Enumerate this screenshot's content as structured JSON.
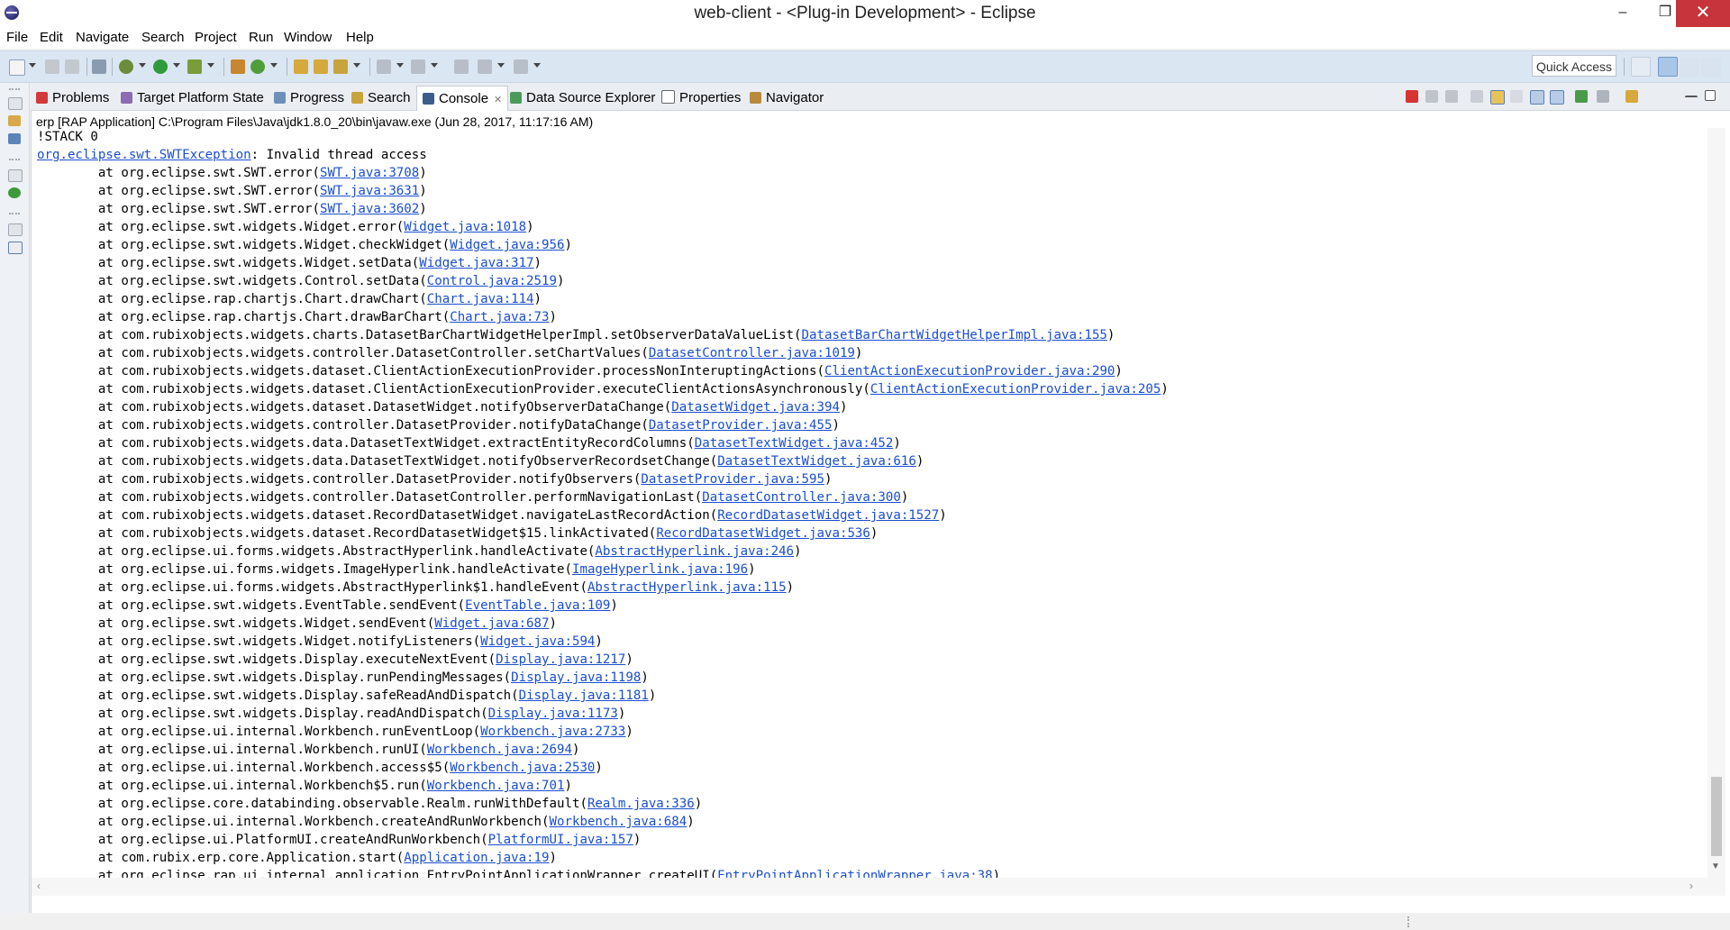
{
  "window": {
    "title": "web-client - <Plug-in Development> - Eclipse",
    "minimize": "–",
    "maximize": "❐",
    "close": "✕"
  },
  "menu": [
    "File",
    "Edit",
    "Navigate",
    "Search",
    "Project",
    "Run",
    "Window",
    "Help"
  ],
  "toolbar": {
    "quick_access": "Quick Access"
  },
  "tabs": {
    "problems": "Problems",
    "target_platform_state": "Target Platform State",
    "progress": "Progress",
    "search": "Search",
    "console": "Console",
    "data_source_explorer": "Data Source Explorer",
    "properties": "Properties",
    "navigator": "Navigator",
    "active": "Console"
  },
  "console": {
    "description": "erp [RAP Application] C:\\Program Files\\Java\\jdk1.8.0_20\\bin\\javaw.exe (Jun 28, 2017, 11:17:16 AM)",
    "lines": [
      {
        "t": "!STACK 0"
      },
      {
        "t": "",
        "l": "org.eclipse.swt.SWTException",
        "s": ": Invalid thread access"
      },
      {
        "t": "\tat org.eclipse.swt.SWT.error(",
        "l": "SWT.java:3708",
        "s": ")"
      },
      {
        "t": "\tat org.eclipse.swt.SWT.error(",
        "l": "SWT.java:3631",
        "s": ")"
      },
      {
        "t": "\tat org.eclipse.swt.SWT.error(",
        "l": "SWT.java:3602",
        "s": ")"
      },
      {
        "t": "\tat org.eclipse.swt.widgets.Widget.error(",
        "l": "Widget.java:1018",
        "s": ")"
      },
      {
        "t": "\tat org.eclipse.swt.widgets.Widget.checkWidget(",
        "l": "Widget.java:956",
        "s": ")"
      },
      {
        "t": "\tat org.eclipse.swt.widgets.Widget.setData(",
        "l": "Widget.java:317",
        "s": ")"
      },
      {
        "t": "\tat org.eclipse.swt.widgets.Control.setData(",
        "l": "Control.java:2519",
        "s": ")"
      },
      {
        "t": "\tat org.eclipse.rap.chartjs.Chart.drawChart(",
        "l": "Chart.java:114",
        "s": ")"
      },
      {
        "t": "\tat org.eclipse.rap.chartjs.Chart.drawBarChart(",
        "l": "Chart.java:73",
        "s": ")"
      },
      {
        "t": "\tat com.rubixobjects.widgets.charts.DatasetBarChartWidgetHelperImpl.setObserverDataValueList(",
        "l": "DatasetBarChartWidgetHelperImpl.java:155",
        "s": ")"
      },
      {
        "t": "\tat com.rubixobjects.widgets.controller.DatasetController.setChartValues(",
        "l": "DatasetController.java:1019",
        "s": ")"
      },
      {
        "t": "\tat com.rubixobjects.widgets.dataset.ClientActionExecutionProvider.processNonInteruptingActions(",
        "l": "ClientActionExecutionProvider.java:290",
        "s": ")"
      },
      {
        "t": "\tat com.rubixobjects.widgets.dataset.ClientActionExecutionProvider.executeClientActionsAsynchronously(",
        "l": "ClientActionExecutionProvider.java:205",
        "s": ")"
      },
      {
        "t": "\tat com.rubixobjects.widgets.dataset.DatasetWidget.notifyObserverDataChange(",
        "l": "DatasetWidget.java:394",
        "s": ")"
      },
      {
        "t": "\tat com.rubixobjects.widgets.controller.DatasetProvider.notifyDataChange(",
        "l": "DatasetProvider.java:455",
        "s": ")"
      },
      {
        "t": "\tat com.rubixobjects.widgets.data.DatasetTextWidget.extractEntityRecordColumns(",
        "l": "DatasetTextWidget.java:452",
        "s": ")"
      },
      {
        "t": "\tat com.rubixobjects.widgets.data.DatasetTextWidget.notifyObserverRecordsetChange(",
        "l": "DatasetTextWidget.java:616",
        "s": ")"
      },
      {
        "t": "\tat com.rubixobjects.widgets.controller.DatasetProvider.notifyObservers(",
        "l": "DatasetProvider.java:595",
        "s": ")"
      },
      {
        "t": "\tat com.rubixobjects.widgets.controller.DatasetController.performNavigationLast(",
        "l": "DatasetController.java:300",
        "s": ")"
      },
      {
        "t": "\tat com.rubixobjects.widgets.dataset.RecordDatasetWidget.navigateLastRecordAction(",
        "l": "RecordDatasetWidget.java:1527",
        "s": ")"
      },
      {
        "t": "\tat com.rubixobjects.widgets.dataset.RecordDatasetWidget$15.linkActivated(",
        "l": "RecordDatasetWidget.java:536",
        "s": ")"
      },
      {
        "t": "\tat org.eclipse.ui.forms.widgets.AbstractHyperlink.handleActivate(",
        "l": "AbstractHyperlink.java:246",
        "s": ")"
      },
      {
        "t": "\tat org.eclipse.ui.forms.widgets.ImageHyperlink.handleActivate(",
        "l": "ImageHyperlink.java:196",
        "s": ")"
      },
      {
        "t": "\tat org.eclipse.ui.forms.widgets.AbstractHyperlink$1.handleEvent(",
        "l": "AbstractHyperlink.java:115",
        "s": ")"
      },
      {
        "t": "\tat org.eclipse.swt.widgets.EventTable.sendEvent(",
        "l": "EventTable.java:109",
        "s": ")"
      },
      {
        "t": "\tat org.eclipse.swt.widgets.Widget.sendEvent(",
        "l": "Widget.java:687",
        "s": ")"
      },
      {
        "t": "\tat org.eclipse.swt.widgets.Widget.notifyListeners(",
        "l": "Widget.java:594",
        "s": ")"
      },
      {
        "t": "\tat org.eclipse.swt.widgets.Display.executeNextEvent(",
        "l": "Display.java:1217",
        "s": ")"
      },
      {
        "t": "\tat org.eclipse.swt.widgets.Display.runPendingMessages(",
        "l": "Display.java:1198",
        "s": ")"
      },
      {
        "t": "\tat org.eclipse.swt.widgets.Display.safeReadAndDispatch(",
        "l": "Display.java:1181",
        "s": ")"
      },
      {
        "t": "\tat org.eclipse.swt.widgets.Display.readAndDispatch(",
        "l": "Display.java:1173",
        "s": ")"
      },
      {
        "t": "\tat org.eclipse.ui.internal.Workbench.runEventLoop(",
        "l": "Workbench.java:2733",
        "s": ")"
      },
      {
        "t": "\tat org.eclipse.ui.internal.Workbench.runUI(",
        "l": "Workbench.java:2694",
        "s": ")"
      },
      {
        "t": "\tat org.eclipse.ui.internal.Workbench.access$5(",
        "l": "Workbench.java:2530",
        "s": ")"
      },
      {
        "t": "\tat org.eclipse.ui.internal.Workbench$5.run(",
        "l": "Workbench.java:701",
        "s": ")"
      },
      {
        "t": "\tat org.eclipse.core.databinding.observable.Realm.runWithDefault(",
        "l": "Realm.java:336",
        "s": ")"
      },
      {
        "t": "\tat org.eclipse.ui.internal.Workbench.createAndRunWorkbench(",
        "l": "Workbench.java:684",
        "s": ")"
      },
      {
        "t": "\tat org.eclipse.ui.PlatformUI.createAndRunWorkbench(",
        "l": "PlatformUI.java:157",
        "s": ")"
      },
      {
        "t": "\tat com.rubix.erp.core.Application.start(",
        "l": "Application.java:19",
        "s": ")"
      },
      {
        "t": "\tat org.eclipse.rap.ui.internal.application.EntryPointApplicationWrapper.createUI(",
        "l": "EntryPointApplicationWrapper.java:38",
        "s": ")"
      }
    ]
  },
  "colors": {
    "link": "#1a4ecf",
    "terminate": "#d63333",
    "toolbar_bg": "#dbe6f3"
  }
}
